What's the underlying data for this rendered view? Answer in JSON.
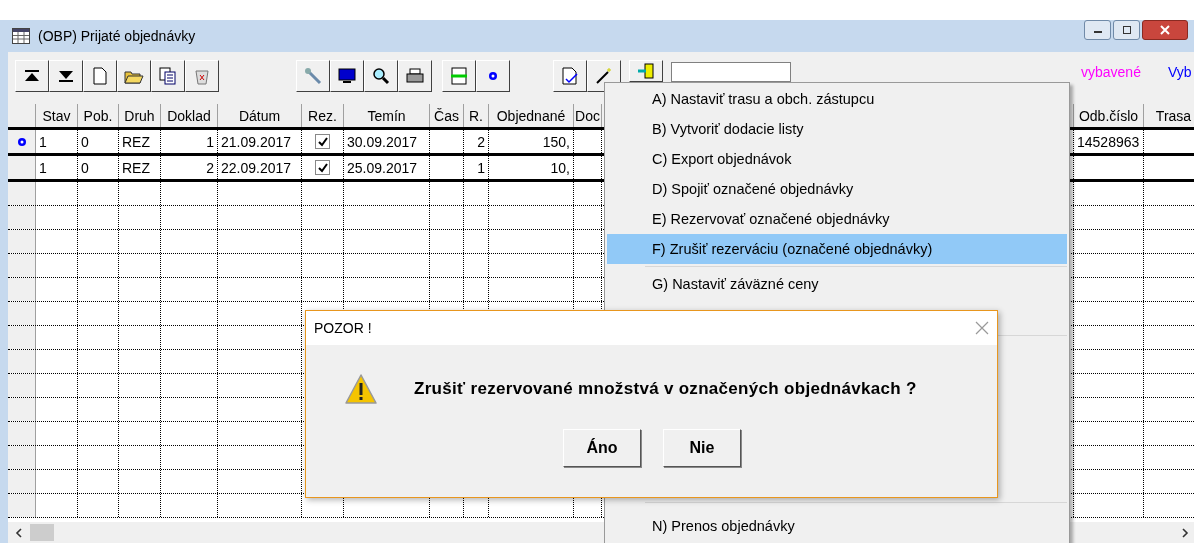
{
  "window": {
    "title": "(OBP) Prijaté objednávky"
  },
  "legend": [
    {
      "text": "vybavené",
      "color": "#ff00ff"
    },
    {
      "text": "Vyb",
      "color": "#0000ff"
    }
  ],
  "table": {
    "columns": [
      "Stav",
      "Pob.",
      "Druh",
      "Doklad",
      "Dátum",
      "Rez.",
      "Temín",
      "Čas",
      "R.",
      "Objednané",
      "Doc",
      "",
      "Odb.číslo",
      "Trasa"
    ],
    "rows": [
      {
        "current": true,
        "cells": [
          "1",
          "0",
          "REZ",
          "1",
          "21.09.2017",
          true,
          "30.09.2017",
          "",
          "2",
          "150,",
          "",
          "",
          "14528963",
          ""
        ]
      },
      {
        "current": false,
        "cells": [
          "1",
          "0",
          "REZ",
          "2",
          "22.09.2017",
          true,
          "25.09.2017",
          "",
          "1",
          "10,",
          "",
          "",
          "",
          ""
        ]
      }
    ]
  },
  "menu": [
    {
      "kind": "item",
      "label": "A) Nastaviť trasu a obch. zástupcu",
      "selected": false
    },
    {
      "kind": "item",
      "label": "B) Vytvoriť dodacie listy",
      "selected": false
    },
    {
      "kind": "item",
      "label": "C) Export objednávok",
      "selected": false
    },
    {
      "kind": "item",
      "label": "D) Spojiť označené objednávky",
      "selected": false
    },
    {
      "kind": "item",
      "label": "E) Rezervovať označené objednávky",
      "selected": false
    },
    {
      "kind": "item",
      "label": "F) Zrušiť rezerváciu (označené objednávky)",
      "selected": true
    },
    {
      "kind": "separator"
    },
    {
      "kind": "item",
      "label": "G) Nastaviť záväzné ceny",
      "selected": false
    },
    {
      "kind": "hidden"
    },
    {
      "kind": "item",
      "label": "N) Prenos objednávky",
      "selected": false
    }
  ],
  "dialog": {
    "title": "POZOR !",
    "message": "Zrušiť rezervované množstvá v označených objednávkach ?",
    "buttons": [
      "Áno",
      "Nie"
    ]
  }
}
